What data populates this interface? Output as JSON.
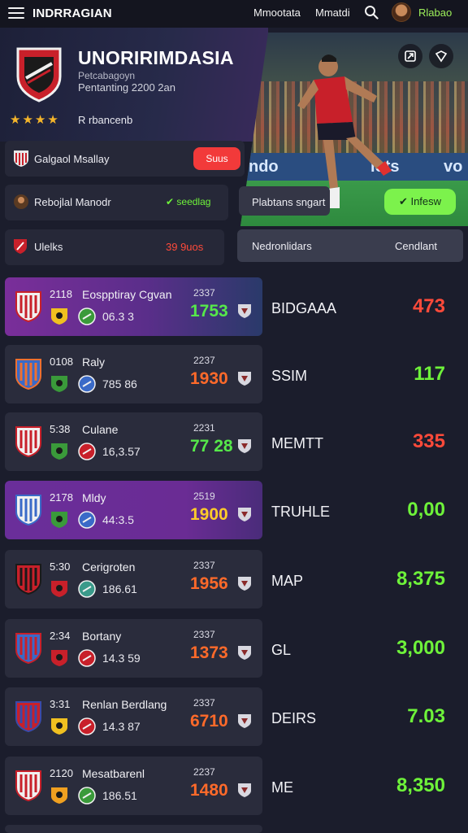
{
  "header": {
    "brand": "INDRRAGIAN",
    "nav": [
      "Mmootata",
      "Mmatdi"
    ],
    "username": "Rlabao"
  },
  "team": {
    "name": "UNORIRIMDASIA",
    "subtitle1": "Petcabagoyn",
    "subtitle2": "Pentanting 2200 2an",
    "stars": "★★★★",
    "star_label": "R rbancenb"
  },
  "photo": {
    "ad_text_1": "ndo",
    "ad_text_2": "iots",
    "ad_text_3": "vo"
  },
  "rows": {
    "r1_label": "Galgaol Msallay",
    "r1_button": "Suus",
    "r2_label": "Rebojlal Manodr",
    "r2_status": "✔ seedlag",
    "r2_right_label": "Plabtans sngart",
    "r2_button": "✔ Infesw",
    "r3_label": "Ulelks",
    "r3_status": "39 9uos",
    "r3_right_label": "Nedronlidars",
    "r3_right_status": "Cendlant"
  },
  "matches": [
    {
      "time": "2118",
      "name": "Eospptiray Cgvan",
      "odds": "06.3 3",
      "small": "2337",
      "score": "1753",
      "score_color": "#56e84a",
      "code": "BIDGAAA",
      "value": "473",
      "value_color": "#ff4a3a"
    },
    {
      "time": "0108",
      "name": "Raly",
      "odds": "785 86",
      "small": "2237",
      "score": "1930",
      "score_color": "#ff6a2a",
      "code": "SSIM",
      "value": "117",
      "value_color": "#6ef23a"
    },
    {
      "time": "5:38",
      "name": "Culane",
      "odds": "16,3.57",
      "small": "2231",
      "score": "77 28",
      "score_color": "#56e84a",
      "code": "MEMTT",
      "value": "335",
      "value_color": "#ff4a3a"
    },
    {
      "time": "2178",
      "name": "Mldy",
      "odds": "44:3.5",
      "small": "2519",
      "score": "1900",
      "score_color": "#ffcc2a",
      "code": "TRUHLE",
      "value": "0,00",
      "value_color": "#6ef23a"
    },
    {
      "time": "5:30",
      "name": "Cerigroten",
      "odds": "186.61",
      "small": "2337",
      "score": "1956",
      "score_color": "#ff6a2a",
      "code": "MAP",
      "value": "8,375",
      "value_color": "#6ef23a"
    },
    {
      "time": "2:34",
      "name": "Bortany",
      "odds": "14.3 59",
      "small": "2337",
      "score": "1373",
      "score_color": "#ff6a2a",
      "code": "GL",
      "value": "3,000",
      "value_color": "#6ef23a"
    },
    {
      "time": "3:31",
      "name": "Renlan Berdlang",
      "odds": "14.3 87",
      "small": "2337",
      "score": "6710",
      "score_color": "#ff6a2a",
      "code": "DEIRS",
      "value": "7.03",
      "value_color": "#6ef23a"
    },
    {
      "time": "2120",
      "name": "Mesatbarenl",
      "odds": "186.51",
      "small": "2237",
      "score": "1480",
      "score_color": "#ff6a2a",
      "code": "ME",
      "value": "8,350",
      "value_color": "#6ef23a"
    }
  ]
}
